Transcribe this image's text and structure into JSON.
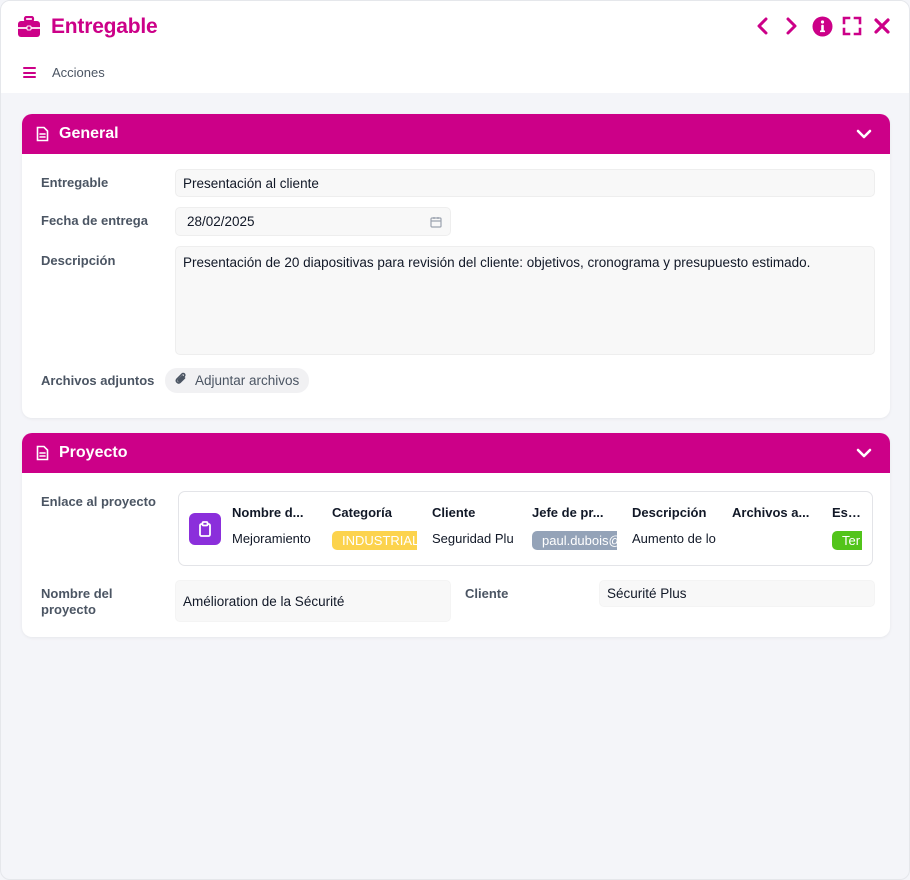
{
  "window": {
    "title": "Entregable",
    "icons": [
      "briefcase-icon",
      "chevron-left-icon",
      "chevron-right-icon",
      "info-icon",
      "fullscreen-icon",
      "close-icon"
    ]
  },
  "toolbar": {
    "actions_label": "Acciones"
  },
  "colors": {
    "accent": "#cc0088",
    "project_icon": "#8b2fdb",
    "tag_category": "#fcd34d",
    "tag_manager": "#94a3b8",
    "tag_status": "#52c41a"
  },
  "general": {
    "title": "General",
    "fields": {
      "entregable_label": "Entregable",
      "entregable_value": "Presentación al cliente",
      "fecha_label": "Fecha de entrega",
      "fecha_value": "28/02/2025",
      "descripcion_label": "Descripción",
      "descripcion_value": "Presentación de 20 diapositivas para revisión del cliente: objetivos, cronograma y presupuesto estimado.",
      "archivos_label": "Archivos adjuntos",
      "adjuntar_button": "Adjuntar archivos"
    }
  },
  "proyecto": {
    "title": "Proyecto",
    "enlace_label": "Enlace al proyecto",
    "columns": [
      {
        "header": "Nombre d...",
        "value": "Mejoramiento"
      },
      {
        "header": "Categoría",
        "value": "INDUSTRIAL"
      },
      {
        "header": "Cliente",
        "value": "Seguridad Plu"
      },
      {
        "header": "Jefe de pr...",
        "value": "paul.dubois@"
      },
      {
        "header": "Descripción",
        "value": "Aumento de lo"
      },
      {
        "header": "Archivos a...",
        "value": ""
      },
      {
        "header": "Estad",
        "value": "Ter"
      }
    ],
    "nombre_label": "Nombre del proyecto",
    "nombre_value": "Amélioration de la Sécurité",
    "cliente_label": "Cliente",
    "cliente_value": "Sécurité Plus"
  }
}
